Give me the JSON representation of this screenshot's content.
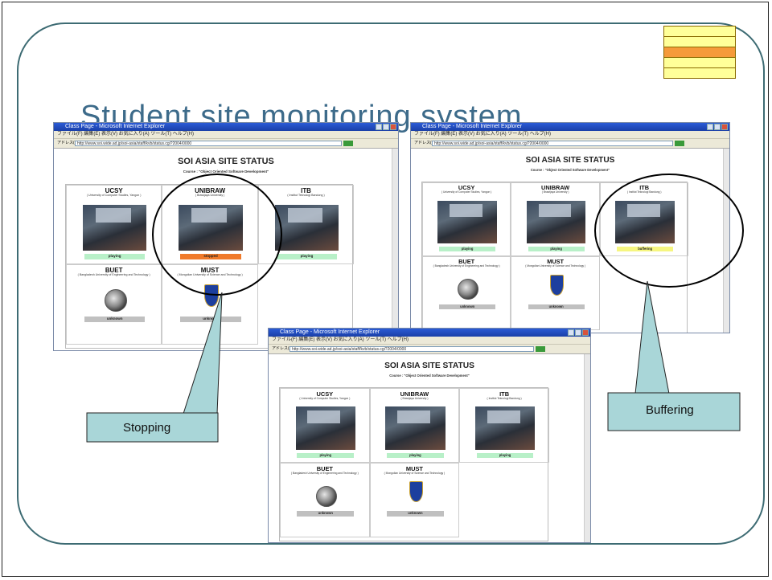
{
  "slide": {
    "title": "Student site monitoring system",
    "swatch_colors": [
      "#ffff99",
      "#ffff99",
      "#f59a3a",
      "#ffff99",
      "#ffff99"
    ]
  },
  "browser": {
    "window_title": "Class Page - Microsoft Internet Explorer",
    "menu": "ファイル(F)  編集(E)  表示(V)  お気に入り(A)  ツール(T)  ヘルプ(H)",
    "address_label": "アドレス(D)",
    "address": "http://www.soi.wide.ad.jp/soi-asia/staff/kvb/status.cgi?2004/0000"
  },
  "page": {
    "heading": "SOI ASIA SITE STATUS",
    "course": "Course : \"Object Oriented Software Development\""
  },
  "sites": [
    {
      "name": "UCSY",
      "uni": "( University of Computer Studies, Yangon )"
    },
    {
      "name": "UNIBRAW",
      "uni": "( Brawijaya University )"
    },
    {
      "name": "ITB",
      "uni": "( Institut Teknologi Bandung )"
    },
    {
      "name": "BUET",
      "uni": "( Bangladesh University of Engineering and Technology )"
    },
    {
      "name": "MUST",
      "uni": "( Mongolian University of Science and Technology )"
    }
  ],
  "status_labels": {
    "playing": "playing",
    "stopped": "stopped",
    "buffering": "buffering",
    "unknown": "unknown"
  },
  "status_colors": {
    "playing": "#b8f0c8",
    "stopped": "#f07a2a",
    "buffering": "#f6f680",
    "unknown": "#c0c0c0"
  },
  "screens": [
    {
      "statuses": [
        "playing",
        "stopped",
        "playing",
        "unknown",
        "unknown"
      ]
    },
    {
      "statuses": [
        "playing",
        "playing",
        "buffering",
        "unknown",
        "unknown"
      ]
    },
    {
      "statuses": [
        "playing",
        "playing",
        "playing",
        "unknown",
        "unknown"
      ]
    }
  ],
  "callouts": {
    "stopping": "Stopping",
    "buffering": "Buffering",
    "fill_color": "#a9d6d8"
  }
}
